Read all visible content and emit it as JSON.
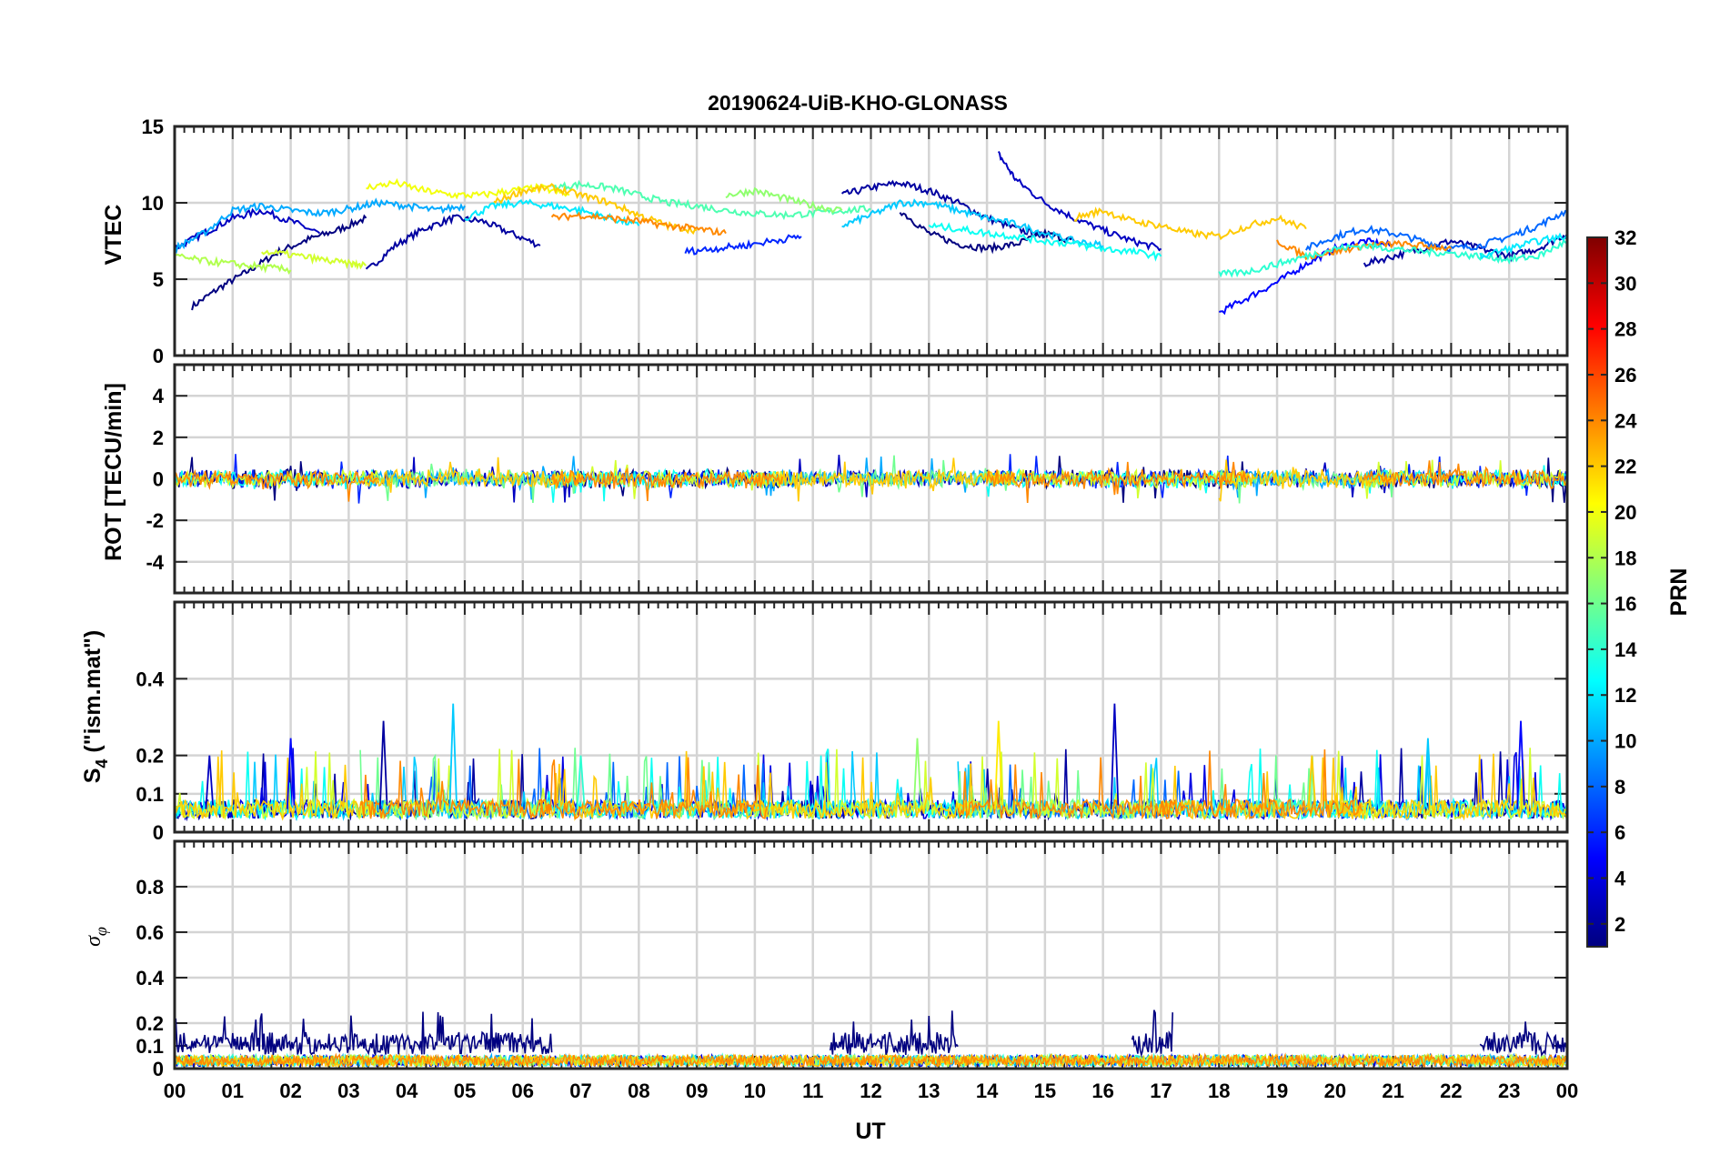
{
  "title": "20190624-UiB-KHO-GLONASS",
  "xlabel": "UT",
  "x_tick_labels": [
    "00",
    "01",
    "02",
    "03",
    "04",
    "05",
    "06",
    "07",
    "08",
    "09",
    "10",
    "11",
    "12",
    "13",
    "14",
    "15",
    "16",
    "17",
    "18",
    "19",
    "20",
    "21",
    "22",
    "23",
    "00"
  ],
  "colorbar": {
    "label": "PRN",
    "colormap": "jet",
    "range": [
      1,
      32
    ],
    "tick_labels": [
      "2",
      "4",
      "6",
      "8",
      "10",
      "12",
      "14",
      "16",
      "18",
      "20",
      "22",
      "24",
      "26",
      "28",
      "30",
      "32"
    ]
  },
  "panels": [
    {
      "id": "vtec",
      "ylabel": "VTEC",
      "ylim": [
        0,
        15
      ],
      "yticks": [
        "0",
        "5",
        "10",
        "15"
      ]
    },
    {
      "id": "rot",
      "ylabel": "ROT [TECU/min]",
      "ylim": [
        -5.5,
        5.5
      ],
      "yticks": [
        "-4",
        "-2",
        "0",
        "2",
        "4"
      ]
    },
    {
      "id": "s4",
      "ylabel_main": "S",
      "ylabel_sub": "4",
      "ylabel_rest": " (\"ism.mat\")",
      "ylim": [
        0,
        0.6
      ],
      "yticks": [
        "0",
        "0.1",
        "0.2",
        "0.4"
      ]
    },
    {
      "id": "sigma",
      "ylabel_main": "σ",
      "ylabel_sub": "φ",
      "ylim": [
        0,
        1
      ],
      "yticks": [
        "0",
        "0.1",
        "0.2",
        "0.4",
        "0.6",
        "0.8"
      ]
    }
  ],
  "chart_data": {
    "type": "line",
    "x_unit": "hours UT",
    "xlim": [
      0,
      24
    ],
    "colors": [
      "#00007f",
      "#0000e0",
      "#0048ff",
      "#00a0ff",
      "#18f0e0",
      "#7cff7a",
      "#e0ff18",
      "#ffb400",
      "#ff5a00"
    ],
    "vtec_series": [
      {
        "prn": 1,
        "x": [
          0.3,
          0.8,
          1.3,
          1.8,
          2.3,
          2.8,
          3.3
        ],
        "y": [
          3.2,
          4.5,
          5.6,
          6.8,
          7.6,
          8.2,
          9.0
        ]
      },
      {
        "prn": 2,
        "x": [
          3.3,
          3.8,
          4.3,
          4.8,
          5.3,
          5.8,
          6.3
        ],
        "y": [
          5.5,
          7.2,
          8.3,
          9.0,
          8.8,
          8.0,
          7.2
        ]
      },
      {
        "prn": 3,
        "x": [
          0,
          0.5,
          1.0,
          1.5,
          2.0,
          2.5
        ],
        "y": [
          7.0,
          8.0,
          9.0,
          9.5,
          8.8,
          8.0
        ]
      },
      {
        "prn": 2,
        "x": [
          11.5,
          12.0,
          12.5,
          13.0,
          13.5,
          14.0,
          14.5,
          15.0
        ],
        "y": [
          10.5,
          11.0,
          11.3,
          10.8,
          10.0,
          9.0,
          8.3,
          7.8
        ]
      },
      {
        "prn": 1,
        "x": [
          12.5,
          13.0,
          13.5,
          14.0,
          14.5,
          15.0,
          15.5
        ],
        "y": [
          9.5,
          8.0,
          7.3,
          7.0,
          7.3,
          8.0,
          7.5
        ]
      },
      {
        "prn": 3,
        "x": [
          14.2,
          14.5,
          15.0,
          15.5,
          16.0,
          16.5,
          17.0
        ],
        "y": [
          13.2,
          11.5,
          10.0,
          9.0,
          8.2,
          7.5,
          7.0
        ]
      },
      {
        "prn": 5,
        "x": [
          18.0,
          18.5,
          19.0,
          19.5,
          20.0,
          20.5,
          21.0
        ],
        "y": [
          2.8,
          3.8,
          4.8,
          6.0,
          7.0,
          7.5,
          7.2
        ]
      },
      {
        "prn": 2,
        "x": [
          20.5,
          21.0,
          21.5,
          22.0,
          22.5,
          23.0,
          23.5,
          24.0
        ],
        "y": [
          6.0,
          6.5,
          7.0,
          7.5,
          7.0,
          6.5,
          7.0,
          8.0
        ]
      },
      {
        "prn": 8,
        "x": [
          19.5,
          20.0,
          20.5,
          21.0,
          21.5,
          22.0,
          22.5,
          23.0,
          23.5,
          24.0
        ],
        "y": [
          7.0,
          7.8,
          8.3,
          8.0,
          7.5,
          7.0,
          7.2,
          7.8,
          8.5,
          9.5
        ]
      },
      {
        "prn": 10,
        "x": [
          0,
          0.5,
          1.0,
          1.5,
          2.0,
          2.5,
          3.0,
          3.5,
          4.0,
          4.5,
          5.0
        ],
        "y": [
          7.0,
          8.0,
          9.5,
          9.8,
          9.5,
          9.3,
          9.6,
          10.0,
          9.8,
          9.5,
          9.8
        ]
      },
      {
        "prn": 12,
        "x": [
          5.0,
          5.5,
          6.0,
          6.5,
          7.0,
          7.5,
          8.0
        ],
        "y": [
          9.0,
          9.8,
          10.0,
          9.8,
          9.5,
          9.0,
          8.5
        ]
      },
      {
        "prn": 11,
        "x": [
          11.5,
          12.0,
          12.5,
          13.0,
          13.5,
          14.0,
          14.5,
          15.0,
          15.5,
          16.0
        ],
        "y": [
          8.5,
          9.2,
          10.0,
          10.0,
          9.5,
          9.0,
          8.6,
          8.0,
          7.5,
          7.2
        ]
      },
      {
        "prn": 15,
        "x": [
          6.5,
          7.0,
          7.5,
          8.0,
          8.5,
          9.0,
          9.5,
          10.0,
          10.5,
          11.0,
          11.5,
          12.0
        ],
        "y": [
          11.0,
          11.2,
          11.0,
          10.5,
          10.0,
          9.8,
          9.5,
          9.3,
          9.2,
          9.3,
          9.5,
          9.6
        ]
      },
      {
        "prn": 17,
        "x": [
          9.5,
          10.0,
          10.5,
          11.0,
          11.5
        ],
        "y": [
          10.5,
          10.8,
          10.3,
          9.8,
          9.5
        ]
      },
      {
        "prn": 20,
        "x": [
          3.3,
          3.8,
          4.3,
          4.8,
          5.3,
          5.8,
          6.3,
          6.8
        ],
        "y": [
          11.0,
          11.3,
          10.8,
          10.5,
          10.5,
          10.8,
          11.0,
          10.5
        ]
      },
      {
        "prn": 22,
        "x": [
          5.5,
          6.0,
          6.5,
          7.0,
          7.5,
          8.0,
          8.5,
          9.0
        ],
        "y": [
          10.0,
          10.8,
          11.0,
          10.5,
          10.0,
          9.2,
          8.5,
          8.2
        ]
      },
      {
        "prn": 24,
        "x": [
          6.5,
          7.0,
          7.5,
          8.0,
          8.5,
          9.0,
          9.5
        ],
        "y": [
          9.0,
          9.2,
          9.0,
          8.8,
          8.5,
          8.3,
          8.0
        ]
      },
      {
        "prn": 22,
        "x": [
          15.5,
          16.0,
          16.5,
          17.0,
          17.5,
          18.0,
          18.5,
          19.0,
          19.5
        ],
        "y": [
          9.0,
          9.5,
          8.8,
          8.5,
          8.0,
          7.8,
          8.5,
          9.0,
          8.3
        ]
      },
      {
        "prn": 24,
        "x": [
          19.0,
          19.5,
          20.0,
          20.5,
          21.0,
          21.5,
          22.0
        ],
        "y": [
          7.5,
          6.5,
          6.8,
          7.2,
          7.3,
          7.2,
          7.0
        ]
      },
      {
        "prn": 14,
        "x": [
          18.0,
          18.5,
          19.0,
          19.5,
          20.0,
          20.5,
          21.0,
          21.5,
          22.0,
          22.5,
          23.0,
          23.5,
          24.0
        ],
        "y": [
          5.3,
          5.5,
          6.0,
          6.5,
          7.0,
          7.2,
          7.0,
          6.8,
          6.7,
          6.5,
          6.3,
          6.5,
          7.5
        ]
      },
      {
        "prn": 18,
        "x": [
          0,
          0.5,
          1.0,
          1.5,
          2.0
        ],
        "y": [
          6.5,
          6.2,
          6.0,
          5.8,
          5.6
        ]
      },
      {
        "prn": 19,
        "x": [
          1.5,
          2.0,
          2.5,
          3.0,
          3.3
        ],
        "y": [
          6.8,
          6.6,
          6.3,
          6.0,
          5.9
        ]
      },
      {
        "prn": 6,
        "x": [
          8.8,
          9.3,
          9.8,
          10.3,
          10.8
        ],
        "y": [
          6.8,
          7.0,
          7.2,
          7.5,
          7.8
        ]
      },
      {
        "prn": 13,
        "x": [
          13.0,
          13.5,
          14.0,
          14.5,
          15.0,
          15.5,
          16.0,
          16.5,
          17.0
        ],
        "y": [
          8.5,
          8.3,
          8.0,
          7.8,
          7.5,
          7.3,
          7.0,
          6.8,
          6.5
        ]
      },
      {
        "prn": 12,
        "x": [
          22.5,
          23.0,
          23.5,
          24.0
        ],
        "y": [
          6.5,
          7.0,
          7.5,
          7.8
        ]
      }
    ],
    "rot": {
      "baseline": 0,
      "typical_spread": [
        -0.8,
        0.8
      ],
      "peak_min": -1.5,
      "peak_max": 1.6
    },
    "s4": {
      "baseline_range": [
        0.03,
        0.1
      ],
      "peak_max": 0.38,
      "notable_peaks_hours": [
        0.6,
        2.0,
        3.6,
        4.8,
        7.0,
        12.8,
        14.2,
        16.2,
        19.6,
        21.6,
        23.2
      ]
    },
    "sigma_phi": {
      "prn1_band": [
        0.05,
        0.25
      ],
      "others_band": [
        0,
        0.07
      ],
      "peak_max": 0.27
    }
  }
}
